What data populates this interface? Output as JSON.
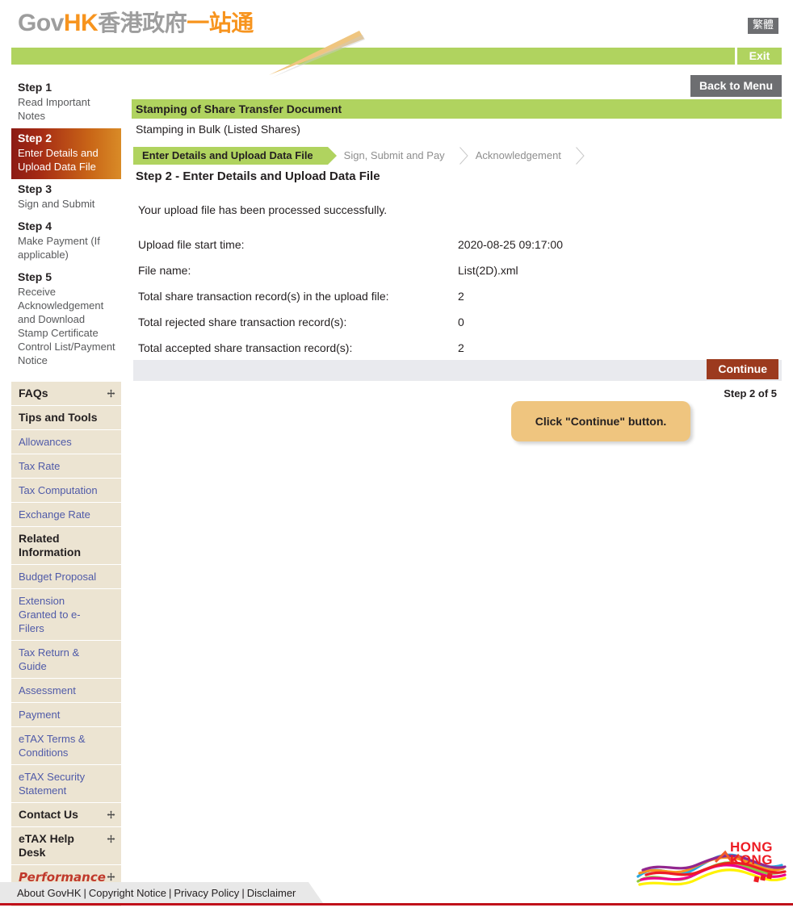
{
  "header": {
    "logo_gov": "Gov",
    "logo_hk": "HK",
    "logo_cn_gray": "香港政府",
    "logo_cn_orange": "一站通",
    "lang_toggle": "繁體",
    "exit_label": "Exit"
  },
  "sidebar": {
    "steps": [
      {
        "title": "Step 1",
        "desc": "Read Important Notes",
        "active": false
      },
      {
        "title": "Step 2",
        "desc": "Enter Details and Upload Data File",
        "active": true
      },
      {
        "title": "Step 3",
        "desc": "Sign and Submit",
        "active": false
      },
      {
        "title": "Step 4",
        "desc": "Make Payment (If applicable)",
        "active": false
      },
      {
        "title": "Step 5",
        "desc": "Receive Acknowledgement and Download Stamp Certificate Control List/Payment Notice",
        "active": false
      }
    ],
    "menu": [
      {
        "label": "FAQs",
        "type": "head",
        "expand": true
      },
      {
        "label": "Tips and Tools",
        "type": "head",
        "expand": false
      },
      {
        "label": "Allowances",
        "type": "link",
        "expand": false
      },
      {
        "label": "Tax Rate",
        "type": "link",
        "expand": false
      },
      {
        "label": "Tax Computation",
        "type": "link",
        "expand": false
      },
      {
        "label": "Exchange Rate",
        "type": "link",
        "expand": false
      },
      {
        "label": "Related Information",
        "type": "head",
        "expand": false
      },
      {
        "label": "Budget Proposal",
        "type": "link",
        "expand": false
      },
      {
        "label": "Extension Granted to e-Filers",
        "type": "link",
        "expand": false
      },
      {
        "label": "Tax Return & Guide",
        "type": "link",
        "expand": false
      },
      {
        "label": "Assessment",
        "type": "link",
        "expand": false
      },
      {
        "label": "Payment",
        "type": "link",
        "expand": false
      },
      {
        "label": "eTAX Terms & Conditions",
        "type": "link",
        "expand": false
      },
      {
        "label": "eTAX Security Statement",
        "type": "link",
        "expand": false
      },
      {
        "label": "Contact Us",
        "type": "head",
        "expand": true
      },
      {
        "label": "eTAX Help Desk",
        "type": "head",
        "expand": true
      },
      {
        "label": "Performance Pledge",
        "type": "pledge",
        "expand": true
      }
    ],
    "expand_icon": "expand-plus-icon"
  },
  "main": {
    "back_to_menu": "Back to Menu",
    "banner_title": "Stamping of Share Transfer Document",
    "subtitle": "Stamping in Bulk (Listed Shares)",
    "tabs": [
      {
        "label": "Enter Details and Upload Data File",
        "active": true
      },
      {
        "label": "Sign, Submit and Pay",
        "active": false
      },
      {
        "label": "Acknowledgement",
        "active": false
      }
    ],
    "step_heading": "Step 2 - Enter Details and Upload Data File",
    "success_message": "Your upload file has been processed successfully.",
    "details": [
      {
        "label": "Upload file start time:",
        "value": "2020-08-25 09:17:00"
      },
      {
        "label": "File name:",
        "value": "List(2D).xml"
      },
      {
        "label": "Total share transaction record(s) in the upload file:",
        "value": "2"
      },
      {
        "label": "Total rejected share transaction record(s):",
        "value": "0"
      },
      {
        "label": "Total accepted share transaction record(s):",
        "value": "2"
      }
    ],
    "continue_label": "Continue",
    "step_counter": "Step 2 of 5",
    "callout_text": "Click \"Continue\" button."
  },
  "footer": {
    "links": [
      "About GovHK",
      "Copyright Notice",
      "Privacy Policy",
      "Disclaimer"
    ],
    "separator": "|",
    "hk_logo_line1": "HONG",
    "hk_logo_line2": "KONG"
  },
  "colors": {
    "green": "#b0d35f",
    "orange": "#f7941e",
    "dark_red": "#9c3a1e",
    "gray_button": "#6d6e71",
    "sidebar_beige": "#ece4d2",
    "link_blue": "#4f5aa8",
    "callout_tan": "#efc57f",
    "footer_red": "#c0101a"
  }
}
